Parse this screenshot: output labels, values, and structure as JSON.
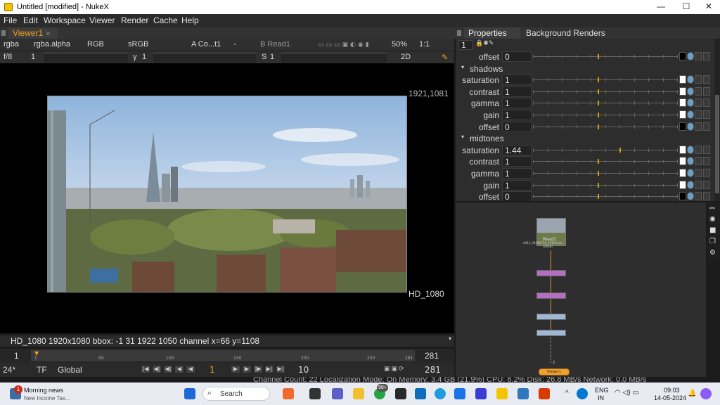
{
  "window": {
    "title": "Untitled [modified] - NukeX"
  },
  "menu": [
    "File",
    "Edit",
    "Workspace",
    "Viewer",
    "Render",
    "Cache",
    "Help"
  ],
  "viewer": {
    "tab": "Viewer1",
    "toolbar1": {
      "channels": "rgba",
      "alpha": "rgba.alpha",
      "colorspace": "RGB",
      "display": "sRGB",
      "a_input": "A Co...t1",
      "op": "-",
      "b_input": "B Read1",
      "zoom": "50%",
      "ratio": "1:1"
    },
    "toolbar2": {
      "fstop": "f/8",
      "gain_val": "1",
      "gamma_label": "γ",
      "gamma_val": "1",
      "s_label": "S",
      "s_val": "1",
      "mode": "2D"
    },
    "format_label_top": "1921,1081",
    "format_label_bottom": "HD_1080",
    "info": "HD_1080 1920x1080  bbox: -1 31 1922 1050 channel  x=66 y=1108",
    "timeline": {
      "start": "1",
      "end": "281",
      "ticks": [
        "1",
        "50",
        "100",
        "150",
        "200",
        "250",
        "281"
      ],
      "current": "1"
    },
    "playback": {
      "fps": "24*",
      "tf": "TF",
      "scope": "Global",
      "frame": "1",
      "step": "10",
      "end_frame": "281"
    }
  },
  "properties": {
    "tabs": [
      "Properties",
      "Background Renders"
    ],
    "count": "1",
    "rows": [
      {
        "type": "param",
        "label": "offset",
        "value": "0",
        "knob": 0.45
      },
      {
        "type": "section",
        "label": "shadows"
      },
      {
        "type": "param",
        "label": "saturation",
        "value": "1",
        "knob": 0.45
      },
      {
        "type": "param",
        "label": "contrast",
        "value": "1",
        "knob": 0.45
      },
      {
        "type": "param",
        "label": "gamma",
        "value": "1",
        "knob": 0.45
      },
      {
        "type": "param",
        "label": "gain",
        "value": "1",
        "knob": 0.45
      },
      {
        "type": "param",
        "label": "offset",
        "value": "0",
        "knob": 0.45
      },
      {
        "type": "section",
        "label": "midtones"
      },
      {
        "type": "param",
        "label": "saturation",
        "value": "1.44",
        "knob": 0.6
      },
      {
        "type": "param",
        "label": "contrast",
        "value": "1",
        "knob": 0.45
      },
      {
        "type": "param",
        "label": "gamma",
        "value": "1",
        "knob": 0.45
      },
      {
        "type": "param",
        "label": "gain",
        "value": "1",
        "knob": 0.45
      },
      {
        "type": "param",
        "label": "offset",
        "value": "0",
        "knob": 0.45
      }
    ]
  },
  "nodegraph": {
    "read_node": "Read1",
    "read_file": "A013_03080754_C016.braw",
    "read_cs": "(sRGB)",
    "viewer_node": "Viewer1",
    "viewer_input": "2"
  },
  "status": "Channel Count: 22  Localization Mode: On  Memory: 3.4 GB (21.9%)  CPU: 6.2%  Disk: 26.8 MB/s  Network: 0.0 MB/s",
  "taskbar": {
    "news_title": "Morning news",
    "news_sub": "New Income Tax...",
    "news_badge": "1",
    "search": "Search",
    "badge99": "99+",
    "lang": "ENG",
    "region": "IN",
    "time": "09:03",
    "date": "14-05-2024"
  }
}
